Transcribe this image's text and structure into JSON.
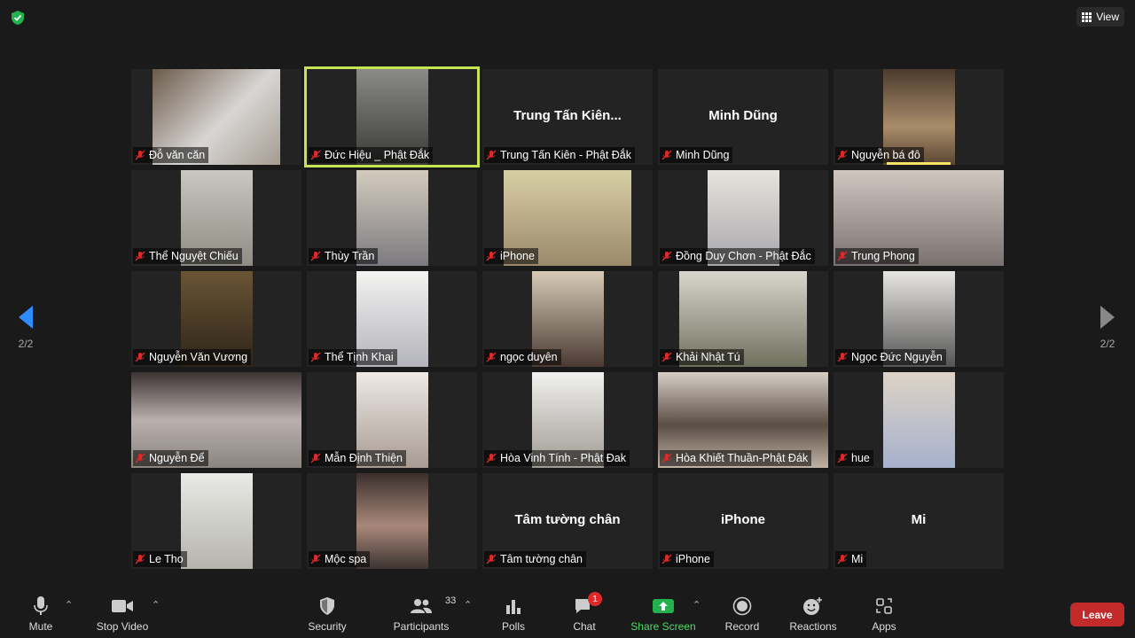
{
  "header": {
    "view_label": "View"
  },
  "nav": {
    "left_page": "2/2",
    "right_page": "2/2"
  },
  "tiles": [
    {
      "name": "Đỗ văn căn",
      "tile_name": ""
    },
    {
      "name": "Đức Hiệu _ Phật Đắk",
      "tile_name": ""
    },
    {
      "name": "Trung Tấn Kiên - Phật Đắk",
      "tile_name": "Trung Tấn Kiên..."
    },
    {
      "name": "Minh Dũng",
      "tile_name": "Minh Dũng"
    },
    {
      "name": "Nguyễn bá đô",
      "tile_name": ""
    },
    {
      "name": "Thể Nguyệt Chiếu",
      "tile_name": ""
    },
    {
      "name": "Thùy Trần",
      "tile_name": ""
    },
    {
      "name": "iPhone",
      "tile_name": ""
    },
    {
      "name": "Đồng Duy Chơn - Phật Đắc",
      "tile_name": ""
    },
    {
      "name": "Trung Phong",
      "tile_name": ""
    },
    {
      "name": "Nguyễn Văn Vương",
      "tile_name": ""
    },
    {
      "name": "Thể Tịnh Khai",
      "tile_name": ""
    },
    {
      "name": "ngọc duyên",
      "tile_name": ""
    },
    {
      "name": "Khải Nhật Tú",
      "tile_name": ""
    },
    {
      "name": "Ngọc Đức Nguyễn",
      "tile_name": ""
    },
    {
      "name": "Nguyễn Để",
      "tile_name": ""
    },
    {
      "name": "Mẫn Định Thiện",
      "tile_name": ""
    },
    {
      "name": "Hòa Vinh Tính - Phật Đak",
      "tile_name": ""
    },
    {
      "name": "Hòa Khiết Thuần-Phật Đák",
      "tile_name": ""
    },
    {
      "name": "hue",
      "tile_name": ""
    },
    {
      "name": "Le Tho",
      "tile_name": ""
    },
    {
      "name": "Mộc spa",
      "tile_name": ""
    },
    {
      "name": "Tâm tường chân",
      "tile_name": "Tâm tường chân"
    },
    {
      "name": "iPhone",
      "tile_name": "iPhone"
    },
    {
      "name": "Mi",
      "tile_name": "Mi"
    }
  ],
  "toolbar": {
    "mute": "Mute",
    "stop_video": "Stop Video",
    "security": "Security",
    "participants": "Participants",
    "participants_count": "33",
    "polls": "Polls",
    "chat": "Chat",
    "chat_badge": "1",
    "share_screen": "Share Screen",
    "record": "Record",
    "reactions": "Reactions",
    "apps": "Apps",
    "leave": "Leave"
  },
  "colors": {
    "share_green": "#4cd964",
    "leave_red": "#c32b2b",
    "active_speaker": "#c6e353",
    "nav_blue": "#2d8cff"
  }
}
